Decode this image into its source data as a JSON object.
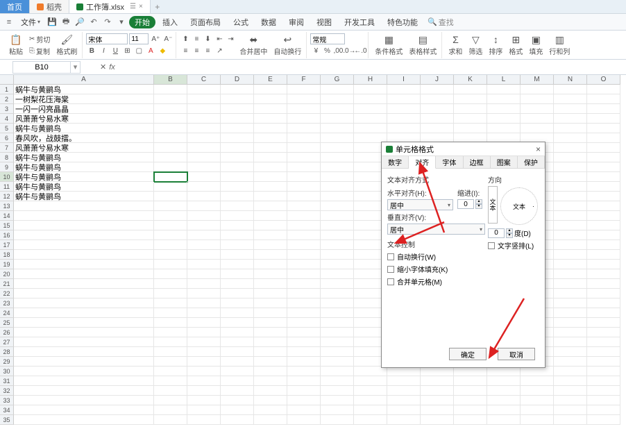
{
  "tabs": {
    "home": "首页",
    "doc1": "稻壳",
    "doc2": "工作簿.xlsx",
    "add": "+"
  },
  "menu": {
    "file": "文件",
    "items": [
      "开始",
      "插入",
      "页面布局",
      "公式",
      "数据",
      "审阅",
      "视图",
      "开发工具",
      "特色功能"
    ],
    "search_icon": "🔍",
    "search": "查找"
  },
  "ribbon": {
    "paste": "粘贴",
    "cut": "剪切",
    "copy": "复制",
    "format_painter": "格式刷",
    "font_name": "宋体",
    "font_size": "11",
    "normal_style": "常规",
    "merge_center": "合并居中",
    "wrap": "自动换行",
    "cond_format": "条件格式",
    "table_style": "表格样式",
    "sum": "求和",
    "filter": "筛选",
    "sort": "排序",
    "format": "格式",
    "fill": "填充",
    "row_col": "行和列"
  },
  "formula": {
    "name_box": "B10",
    "fx": "fx"
  },
  "columns": [
    "A",
    "B",
    "C",
    "D",
    "E",
    "F",
    "G",
    "H",
    "I",
    "J",
    "K",
    "L",
    "M",
    "N",
    "O"
  ],
  "rows": [
    "1",
    "2",
    "3",
    "4",
    "5",
    "6",
    "7",
    "8",
    "9",
    "10",
    "11",
    "12",
    "13",
    "14",
    "15",
    "16",
    "17",
    "18",
    "19",
    "20",
    "21",
    "22",
    "23",
    "24",
    "25",
    "26",
    "27",
    "28",
    "29",
    "30",
    "31",
    "32",
    "33",
    "34",
    "35"
  ],
  "cells": {
    "A1": "蜗牛与黄鹂鸟",
    "A2": "一树梨花压海棠",
    "A3": "一闪一闪亮晶晶",
    "A4": "风萧萧兮易水寒",
    "A5": "蜗牛与黄鹂鸟",
    "A6": "春风吹，战鼓擂。",
    "A7": "风萧萧兮易水寒",
    "A8": "蜗牛与黄鹂鸟",
    "A9": "蜗牛与黄鹂鸟",
    "A10": "蜗牛与黄鹂鸟",
    "A11": "蜗牛与黄鹂鸟",
    "A12": "蜗牛与黄鹂鸟"
  },
  "selected_cell": "B10",
  "dialog": {
    "title": "单元格格式",
    "tabs": [
      "数字",
      "对齐",
      "字体",
      "边框",
      "图案",
      "保护"
    ],
    "active_tab": "对齐",
    "text_align_section": "文本对齐方式",
    "h_align_label": "水平对齐(H):",
    "h_align_value": "居中",
    "v_align_label": "垂直对齐(V):",
    "v_align_value": "居中",
    "indent_label": "缩进(I):",
    "indent_value": "0",
    "text_control_section": "文本控制",
    "wrap_check": "自动换行(W)",
    "shrink_check": "缩小字体填充(K)",
    "merge_check": "合并单元格(M)",
    "direction_section": "方向",
    "orient_v": "文本",
    "orient_h": "文本",
    "degree_value": "0",
    "degree_label": "度(D)",
    "vertical_text": "文字竖排(L)",
    "ok": "确定",
    "cancel": "取消"
  }
}
